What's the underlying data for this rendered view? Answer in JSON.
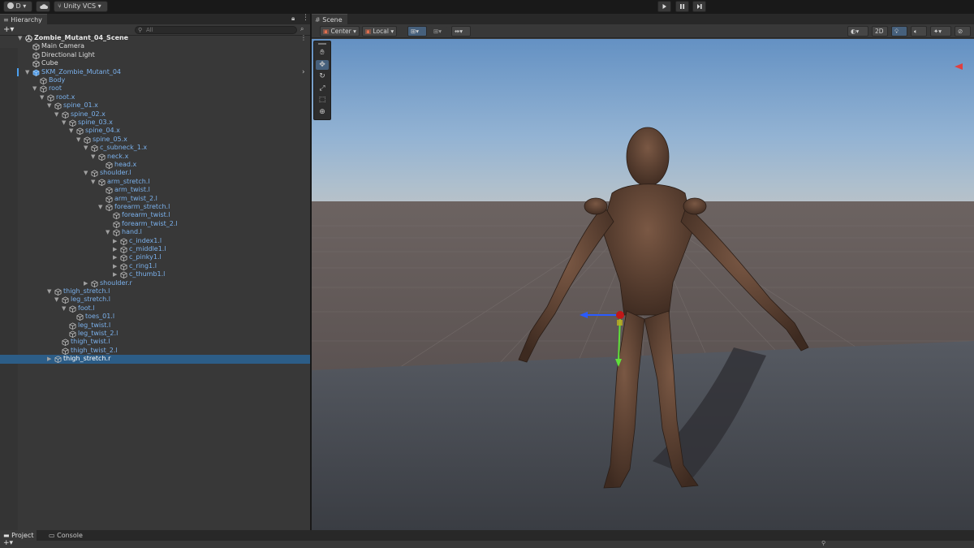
{
  "toolbar": {
    "account_label": "D",
    "account_icon": "account-icon",
    "cloud_icon": "cloud-icon",
    "vcs_label": "Unity VCS",
    "play_icons": [
      "play-icon",
      "pause-icon",
      "step-icon"
    ]
  },
  "hierarchy": {
    "tab_label": "Hierarchy",
    "search_placeholder": "All",
    "add_label": "+▾",
    "rows": [
      {
        "label": "Zombie_Mutant_04_Scene",
        "depth": 0,
        "fold": "open",
        "kind": "scene"
      },
      {
        "label": "Main Camera",
        "depth": 1,
        "fold": "none",
        "kind": "white"
      },
      {
        "label": "Directional Light",
        "depth": 1,
        "fold": "none",
        "kind": "white"
      },
      {
        "label": "Cube",
        "depth": 1,
        "fold": "none",
        "kind": "white"
      },
      {
        "label": "SKM_Zombie_Mutant_04",
        "depth": 1,
        "fold": "open",
        "kind": "prefab-root"
      },
      {
        "label": "Body",
        "depth": 2,
        "fold": "none",
        "kind": "prefab"
      },
      {
        "label": "root",
        "depth": 2,
        "fold": "open",
        "kind": "prefab"
      },
      {
        "label": "root.x",
        "depth": 3,
        "fold": "open",
        "kind": "prefab"
      },
      {
        "label": "spine_01.x",
        "depth": 4,
        "fold": "open",
        "kind": "prefab"
      },
      {
        "label": "spine_02.x",
        "depth": 5,
        "fold": "open",
        "kind": "prefab"
      },
      {
        "label": "spine_03.x",
        "depth": 6,
        "fold": "open",
        "kind": "prefab"
      },
      {
        "label": "spine_04.x",
        "depth": 7,
        "fold": "open",
        "kind": "prefab"
      },
      {
        "label": "spine_05.x",
        "depth": 8,
        "fold": "open",
        "kind": "prefab"
      },
      {
        "label": "c_subneck_1.x",
        "depth": 9,
        "fold": "open",
        "kind": "prefab"
      },
      {
        "label": "neck.x",
        "depth": 10,
        "fold": "open",
        "kind": "prefab"
      },
      {
        "label": "head.x",
        "depth": 11,
        "fold": "none",
        "kind": "prefab"
      },
      {
        "label": "shoulder.l",
        "depth": 9,
        "fold": "open",
        "kind": "prefab"
      },
      {
        "label": "arm_stretch.l",
        "depth": 10,
        "fold": "open",
        "kind": "prefab"
      },
      {
        "label": "arm_twist.l",
        "depth": 11,
        "fold": "none",
        "kind": "prefab"
      },
      {
        "label": "arm_twist_2.l",
        "depth": 11,
        "fold": "none",
        "kind": "prefab"
      },
      {
        "label": "forearm_stretch.l",
        "depth": 11,
        "fold": "open",
        "kind": "prefab"
      },
      {
        "label": "forearm_twist.l",
        "depth": 12,
        "fold": "none",
        "kind": "prefab"
      },
      {
        "label": "forearm_twist_2.l",
        "depth": 12,
        "fold": "none",
        "kind": "prefab"
      },
      {
        "label": "hand.l",
        "depth": 12,
        "fold": "open",
        "kind": "prefab"
      },
      {
        "label": "c_index1.l",
        "depth": 13,
        "fold": "closed",
        "kind": "prefab"
      },
      {
        "label": "c_middle1.l",
        "depth": 13,
        "fold": "closed",
        "kind": "prefab"
      },
      {
        "label": "c_pinky1.l",
        "depth": 13,
        "fold": "closed",
        "kind": "prefab"
      },
      {
        "label": "c_ring1.l",
        "depth": 13,
        "fold": "closed",
        "kind": "prefab"
      },
      {
        "label": "c_thumb1.l",
        "depth": 13,
        "fold": "closed",
        "kind": "prefab"
      },
      {
        "label": "shoulder.r",
        "depth": 9,
        "fold": "closed",
        "kind": "prefab"
      },
      {
        "label": "thigh_stretch.l",
        "depth": 4,
        "fold": "open",
        "kind": "prefab"
      },
      {
        "label": "leg_stretch.l",
        "depth": 5,
        "fold": "open",
        "kind": "prefab"
      },
      {
        "label": "foot.l",
        "depth": 6,
        "fold": "open",
        "kind": "prefab"
      },
      {
        "label": "toes_01.l",
        "depth": 7,
        "fold": "none",
        "kind": "prefab"
      },
      {
        "label": "leg_twist.l",
        "depth": 6,
        "fold": "none",
        "kind": "prefab"
      },
      {
        "label": "leg_twist_2.l",
        "depth": 6,
        "fold": "none",
        "kind": "prefab"
      },
      {
        "label": "thigh_twist.l",
        "depth": 5,
        "fold": "none",
        "kind": "prefab"
      },
      {
        "label": "thigh_twist_2.l",
        "depth": 5,
        "fold": "none",
        "kind": "prefab"
      },
      {
        "label": "thigh_stretch.r",
        "depth": 4,
        "fold": "closed",
        "kind": "prefab",
        "selected": true
      }
    ]
  },
  "scene": {
    "tab_label": "Scene",
    "pivot_label": "Center",
    "space_label": "Local",
    "mode_2d_label": "2D",
    "tools": [
      "hand-tool-icon",
      "move-tool-icon",
      "rotate-tool-icon",
      "scale-tool-icon",
      "rect-tool-icon",
      "transform-tool-icon"
    ],
    "active_tool": "move-tool-icon"
  },
  "bottom": {
    "tabs": [
      "Project",
      "Console"
    ],
    "active_tab": "Project"
  },
  "colors": {
    "prefab_text": "#7bb1ec",
    "selection": "#2c5d87",
    "sky_top": "#6a98c8",
    "ground": "#4f4747"
  }
}
